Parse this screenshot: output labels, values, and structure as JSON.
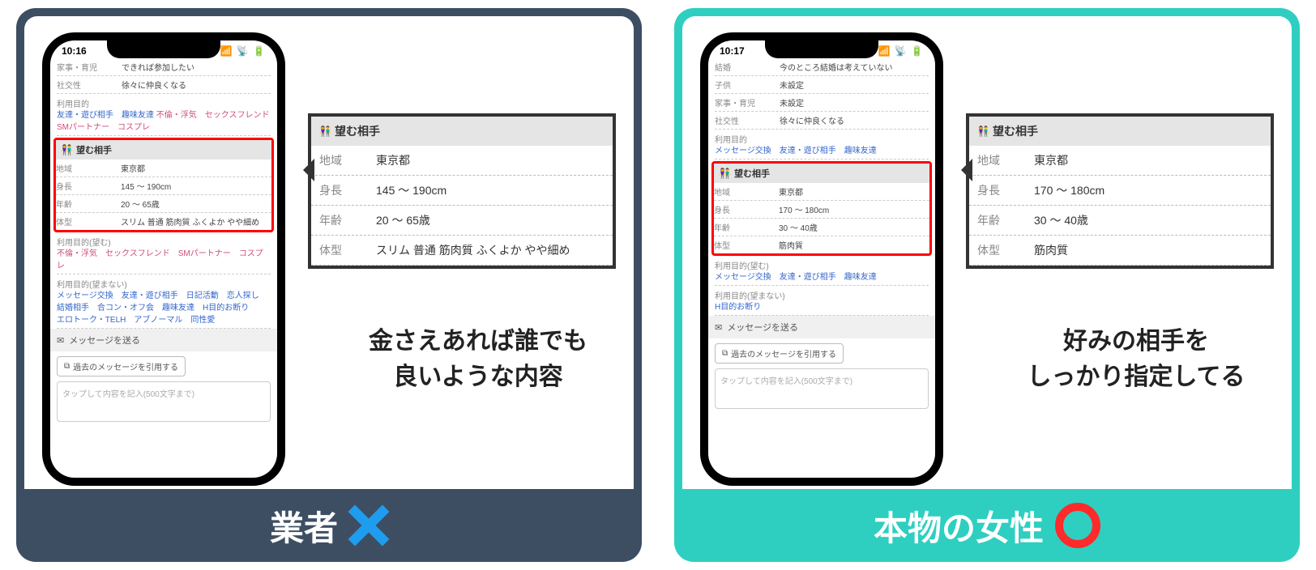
{
  "left": {
    "status_time": "10:16",
    "profile_top": [
      {
        "k": "家事・育児",
        "v": "できれば参加したい"
      },
      {
        "k": "社交性",
        "v": "徐々に仲良くなる"
      }
    ],
    "purpose_label": "利用目的",
    "purpose_tags_blue": "友達・遊び相手　趣味友達",
    "purpose_tags_pink1": "不倫・浮気　セックスフレンド",
    "purpose_tags_pink2": "SMパートナー　コスプレ",
    "wish_header": "望む相手",
    "wish_rows": [
      {
        "k": "地域",
        "v": "東京都"
      },
      {
        "k": "身長",
        "v": "145 ～ 190cm"
      },
      {
        "k": "年齢",
        "v": "20 ～ 65歳"
      },
      {
        "k": "体型",
        "v": "スリム 普通 筋肉質 ふくよか やや細め"
      }
    ],
    "purpose2_label": "利用目的(望む)",
    "purpose2_pink": "不倫・浮気　セックスフレンド　SMパートナー　コスプレ",
    "purpose3_label": "利用目的(望まない)",
    "purpose3_blue": "メッセージ交換　友達・遊び相手　日記活動　恋人探し\n結婚相手　合コン・オフ会　趣味友達　H目的お断り\nエロトーク・TELH　アブノーマル　同性愛",
    "msg_header": "メッセージを送る",
    "quote_label": "過去のメッセージを引用する",
    "placeholder": "タップして内容を記入(500文字まで)",
    "callout_rows": [
      {
        "k": "地域",
        "v": "東京都"
      },
      {
        "k": "身長",
        "v": "145 ～ 190cm"
      },
      {
        "k": "年齢",
        "v": "20 ～ 65歳"
      },
      {
        "k": "体型",
        "v": "スリム 普通 筋肉質 ふくよか やや細め"
      }
    ],
    "caption_l1": "金さえあれば誰でも",
    "caption_l2": "良いような内容",
    "footer": "業者"
  },
  "right": {
    "status_time": "10:17",
    "profile_top": [
      {
        "k": "結婚",
        "v": "今のところ結婚は考えていない"
      },
      {
        "k": "子供",
        "v": "未設定"
      },
      {
        "k": "家事・育児",
        "v": "未設定"
      },
      {
        "k": "社交性",
        "v": "徐々に仲良くなる"
      }
    ],
    "purpose_label": "利用目的",
    "purpose_tags_blue": "メッセージ交換　友達・遊び相手　趣味友達",
    "wish_header": "望む相手",
    "wish_rows": [
      {
        "k": "地域",
        "v": "東京都"
      },
      {
        "k": "身長",
        "v": "170 ～ 180cm"
      },
      {
        "k": "年齢",
        "v": "30 ～ 40歳"
      },
      {
        "k": "体型",
        "v": "筋肉質"
      }
    ],
    "purpose2_label": "利用目的(望む)",
    "purpose2_blue": "メッセージ交換　友達・遊び相手　趣味友達",
    "purpose3_label": "利用目的(望まない)",
    "purpose3_blue": "H目的お断り",
    "msg_header": "メッセージを送る",
    "quote_label": "過去のメッセージを引用する",
    "placeholder": "タップして内容を記入(500文字まで)",
    "callout_rows": [
      {
        "k": "地域",
        "v": "東京都"
      },
      {
        "k": "身長",
        "v": "170 ～ 180cm"
      },
      {
        "k": "年齢",
        "v": "30 ～ 40歳"
      },
      {
        "k": "体型",
        "v": "筋肉質"
      }
    ],
    "caption_l1": "好みの相手を",
    "caption_l2": "しっかり指定してる",
    "footer": "本物の女性"
  },
  "status_icons": "📶 📡 🔋"
}
